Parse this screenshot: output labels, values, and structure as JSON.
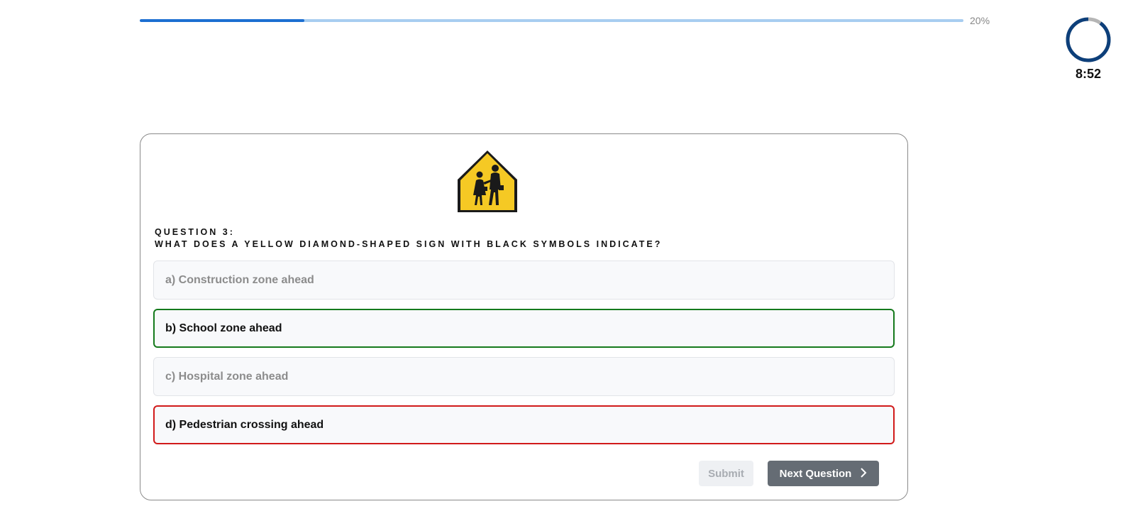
{
  "progress": {
    "value_percent": 20,
    "label": "20%",
    "track_color": "#a8cdf0",
    "fill_color": "#1c6fd1"
  },
  "timer": {
    "time": "8:52",
    "ring_fraction_remaining": 0.9,
    "ring_color": "#0d3f7a",
    "ring_track_color": "#b5b5b5"
  },
  "question": {
    "number_label": "Question 3:",
    "text": "What does a yellow diamond-shaped sign with black symbols indicate?",
    "image_icon": "school-crossing-sign-icon"
  },
  "options": [
    {
      "label": "a) Construction zone ahead",
      "state": "neutral"
    },
    {
      "label": "b) School zone ahead",
      "state": "correct"
    },
    {
      "label": "c) Hospital zone ahead",
      "state": "neutral"
    },
    {
      "label": "d) Pedestrian crossing ahead",
      "state": "wrong"
    }
  ],
  "buttons": {
    "submit_label": "Submit",
    "next_label": "Next Question",
    "next_icon": "chevron-right-icon"
  },
  "colors": {
    "correct": "#157a1c",
    "wrong": "#d11a1a",
    "sign_yellow": "#f5c924"
  }
}
